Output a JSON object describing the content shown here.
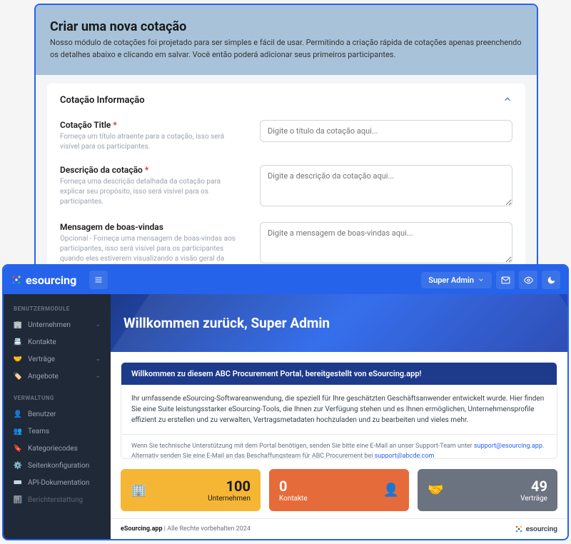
{
  "screen1": {
    "title": "Criar uma nova cotação",
    "subtitle": "Nosso módulo de cotações foi projetado para ser simples e fácil de usar. Permitindo a criação rápida de cotações apenas preenchendo os detalhes abaixo e clicando em salvar. Você então poderá adicionar seus primeiros participantes.",
    "sectionTitle": "Cotação Informação",
    "fields": {
      "title": {
        "label": "Cotação Title",
        "help": "Forneça um título atraente para a cotação, isso será visível para os participantes.",
        "placeholder": "Digite o título da cotação aqui..."
      },
      "desc": {
        "label": "Descrição da cotação",
        "help": "Forneça uma descrição detalhada da cotação para explicar seu propósito, isso será visível para os participantes.",
        "placeholder": "Digite a descrição da cotação aqui..."
      },
      "welcome": {
        "label": "Mensagem de boas-vindas",
        "help": "Opcional - Forneça uma mensagem de boas-vindas aos participantes, isso será visível para os participantes quando eles estiverem visualizando a visão geral da cotação.",
        "placeholder": "Digite a mensagem de boas-vindas aqui..."
      }
    }
  },
  "screen2": {
    "logo": "esourcing",
    "user": "Super Admin",
    "sidebar": {
      "section1": "BENUTZERMODULE",
      "items1": [
        "Unternehmen",
        "Kontakte",
        "Verträge",
        "Angebote"
      ],
      "section2": "VERWALTUNG",
      "items2": [
        "Benutzer",
        "Teams",
        "Kategoriecodes",
        "Seitenkonfiguration",
        "API-Dokumentation",
        "Berichterstattung"
      ]
    },
    "heroTitle": "Willkommen zurück, Super Admin",
    "welcomeCard": {
      "head": "Willkommen zu diesem ABC Procurement Portal, bereitgestellt von eSourcing.app!",
      "body": "Ihr umfassende eSourcing-Softwareanwendung, die speziell für Ihre geschätzten Geschäftsanwender entwickelt wurde. Hier finden Sie eine Suite leistungsstarker eSourcing-Tools, die Ihnen zur Verfügung stehen und es Ihnen ermöglichen, Unternehmensprofile effizient zu erstellen und zu verwalten, Vertragsmetadaten hochzuladen und zu bearbeiten und vieles mehr.",
      "foot1": "Wenn Sie technische Unterstützung mit dem Portal benötigen, senden Sie bitte eine E-Mail an unser Support-Team unter ",
      "link1": "support@esourcing.app",
      "foot2": ". Alternativ senden Sie eine E-Mail an das Beschaffungsteam für ABC Procurement bei ",
      "link2": "support@abcde.com"
    },
    "stats": {
      "s1": {
        "num": "100",
        "lbl": "Unternehmen"
      },
      "s2": {
        "num": "0",
        "lbl": "Kontakte"
      },
      "s3": {
        "num": "49",
        "lbl": "Verträge"
      }
    },
    "footer": {
      "brand": "eSourcing.app",
      "text": " | Alle Rechte vorbehalten 2024",
      "logo": "esourcing"
    }
  }
}
